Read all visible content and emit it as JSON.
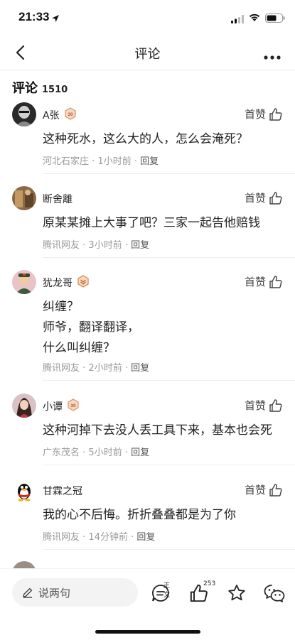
{
  "status_bar": {
    "time": "21:33"
  },
  "nav": {
    "title": "评论"
  },
  "comments_header": {
    "label": "评论",
    "count": "1510"
  },
  "comments": [
    {
      "user": "A张",
      "level": "30",
      "like_label": "首赞",
      "lines": [
        "这种死水，这么大的人，怎么会淹死？"
      ],
      "location": "河北石家庄",
      "time": "1小时前",
      "reply": "回复"
    },
    {
      "user": "断舍離",
      "level": "",
      "like_label": "首赞",
      "lines": [
        "原某某摊上大事了吧？三家一起告他赔钱"
      ],
      "location": "腾讯网友",
      "time": "3小时前",
      "reply": "回复"
    },
    {
      "user": "犹龙哥",
      "level": "medal",
      "like_label": "首赞",
      "lines": [
        "纠缠？",
        "师爷，翻译翻译，",
        "什么叫纠缠？"
      ],
      "location": "腾讯网友",
      "time": "2小时前",
      "reply": "回复"
    },
    {
      "user": "小谭",
      "level": "30",
      "like_label": "首赞",
      "lines": [
        "这种河掉下去没人丢工具下来，基本也会死"
      ],
      "location": "广东茂名",
      "time": "5小时前",
      "reply": "回复"
    },
    {
      "user": "甘霖之冠",
      "level": "",
      "like_label": "首赞",
      "lines": [
        "我的心不后悔。折折叠叠都是为了你"
      ],
      "location": "腾讯网友",
      "time": "14分钟前",
      "reply": "回复"
    }
  ],
  "bottom_bar": {
    "input_placeholder": "说两句",
    "article_badge": "正文",
    "like_count": "253"
  }
}
